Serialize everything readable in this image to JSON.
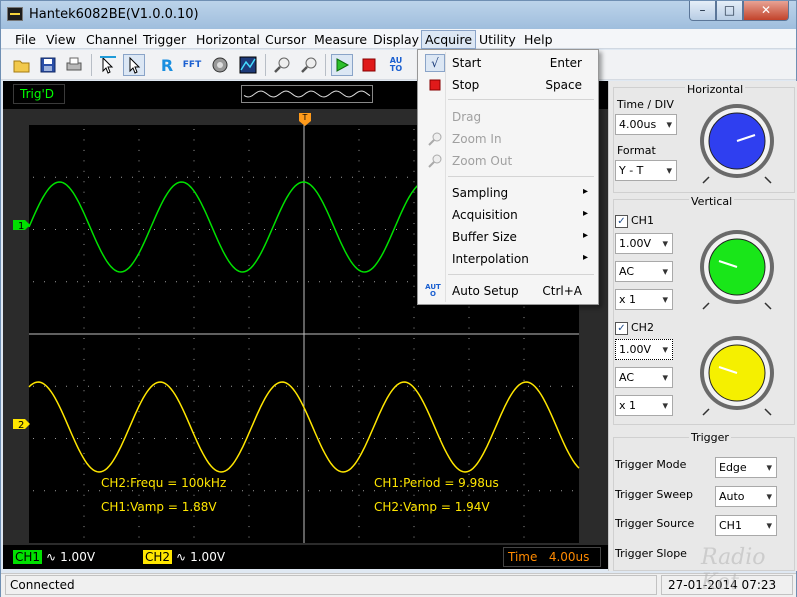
{
  "window": {
    "title": "Hantek6082BE(V1.0.0.10)",
    "min_label": "–",
    "max_label": "□",
    "close_label": "✕"
  },
  "menubar": [
    "File",
    "View",
    "Channel",
    "Trigger",
    "Horizontal",
    "Cursor",
    "Measure",
    "Display",
    "Acquire",
    "Utility",
    "Help"
  ],
  "toolbar": {
    "buttons": [
      "open-icon",
      "save-icon",
      "print-icon",
      "select-icon",
      "pointer-icon",
      "refresh-icon",
      "fft-icon",
      "math-icon",
      "reference-icon",
      "zoom-in-icon",
      "zoom-out-icon",
      "run-icon",
      "stop-icon",
      "auto-icon"
    ],
    "refresh_text": "R",
    "fft_text": "FFT",
    "auto_text": "AU TO"
  },
  "scope": {
    "trig_status": "Trig'D",
    "trigger_marker": "T",
    "ch1_marker": "1",
    "ch2_marker": "2",
    "ch1_color": "#00e000",
    "ch2_color": "#ffe600",
    "measurements": {
      "ch2_freq": "CH2:Frequ = 100kHz",
      "ch1_vamp": "CH1:Vamp = 1.88V",
      "ch1_period": "CH1:Period = 9.98us",
      "ch2_vamp": "CH2:Vamp = 1.94V"
    },
    "bottom": {
      "ch1_name": "CH1",
      "ch1_coupling": "∿",
      "ch1_scale": "1.00V",
      "ch2_name": "CH2",
      "ch2_coupling": "∿",
      "ch2_scale": "1.00V",
      "time_label": "Time",
      "time_value": "4.00us"
    }
  },
  "acquire_menu": {
    "items": [
      {
        "icon": "√",
        "label": "Start",
        "shortcut": "Enter",
        "disabled": false
      },
      {
        "icon": "stop",
        "label": "Stop",
        "shortcut": "Space",
        "disabled": false
      },
      {
        "icon": "",
        "label": "Drag",
        "shortcut": "",
        "disabled": true
      },
      {
        "icon": "zoom",
        "label": "Zoom In",
        "shortcut": "",
        "disabled": true
      },
      {
        "icon": "zoom",
        "label": "Zoom Out",
        "shortcut": "",
        "disabled": true
      },
      {
        "icon": "",
        "label": "Sampling",
        "shortcut": "▸",
        "disabled": false
      },
      {
        "icon": "",
        "label": "Acquisition",
        "shortcut": "▸",
        "disabled": false
      },
      {
        "icon": "",
        "label": "Buffer Size",
        "shortcut": "▸",
        "disabled": false
      },
      {
        "icon": "",
        "label": "Interpolation",
        "shortcut": "▸",
        "disabled": false
      },
      {
        "icon": "AUTO",
        "label": "Auto Setup",
        "shortcut": "Ctrl+A",
        "disabled": false
      }
    ]
  },
  "right_panel": {
    "horizontal": {
      "title": "Horizontal",
      "time_div_label": "Time / DIV",
      "time_div_value": "4.00us",
      "format_label": "Format",
      "format_value": "Y - T",
      "knob_color": "#2f3ff0"
    },
    "vertical": {
      "title": "Vertical",
      "ch1": {
        "label": "CH1",
        "checked": "✓",
        "volts": "1.00V",
        "coupling": "AC",
        "probe": "x 1",
        "knob_color": "#19e619"
      },
      "ch2": {
        "label": "CH2",
        "checked": "✓",
        "volts": "1.00V",
        "coupling": "AC",
        "probe": "x 1",
        "knob_color": "#f5f000"
      }
    },
    "trigger": {
      "title": "Trigger",
      "mode_label": "Trigger Mode",
      "mode_value": "Edge",
      "sweep_label": "Trigger Sweep",
      "sweep_value": "Auto",
      "source_label": "Trigger Source",
      "source_value": "CH1",
      "slope_label": "Trigger Slope"
    }
  },
  "status": {
    "text": "Connected",
    "datetime": "27-01-2014 07:23"
  },
  "watermark": "Radio Kot"
}
